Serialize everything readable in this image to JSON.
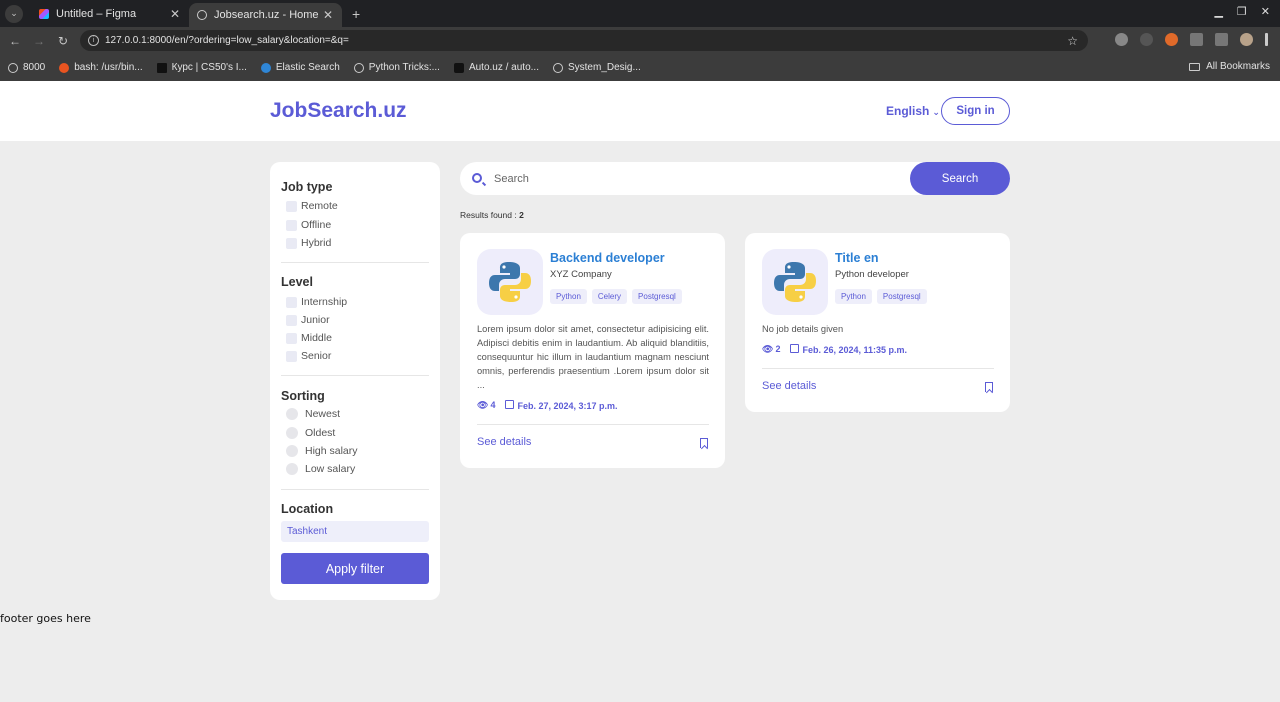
{
  "browser": {
    "tabs": [
      {
        "title": "Untitled – Figma",
        "active": false
      },
      {
        "title": "Jobsearch.uz - Home",
        "active": true
      }
    ],
    "url": "127.0.0.1:8000/en/?ordering=low_salary&location=&q=",
    "bookmarks": [
      "8000",
      "bash: /usr/bin...",
      "Курс | CS50's I...",
      "Elastic Search",
      "Python Tricks:...",
      "Auto.uz / auto...",
      "System_Desig..."
    ],
    "all_bookmarks": "All Bookmarks"
  },
  "header": {
    "logo": "JobSearch.uz",
    "language": "English",
    "signin": "Sign in"
  },
  "filters": {
    "job_type": {
      "title": "Job type",
      "options": [
        "Remote",
        "Offline",
        "Hybrid"
      ]
    },
    "level": {
      "title": "Level",
      "options": [
        "Internship",
        "Junior",
        "Middle",
        "Senior"
      ]
    },
    "sorting": {
      "title": "Sorting",
      "options": [
        "Newest",
        "Oldest",
        "High salary",
        "Low salary"
      ]
    },
    "location": {
      "title": "Location",
      "value": "Tashkent"
    },
    "apply": "Apply filter"
  },
  "search": {
    "placeholder": "Search",
    "button": "Search",
    "results_label": "Results found : ",
    "results_count": "2"
  },
  "jobs": [
    {
      "title": "Backend developer",
      "company": "XYZ Company",
      "tags": [
        "Python",
        "Celery",
        "Postgresql"
      ],
      "description": "Lorem ipsum dolor sit amet, consectetur adipisicing elit. Adipisci debitis enim in laudantium. Ab aliquid blanditiis, consequuntur hic illum in laudantium magnam nesciunt omnis, perferendis praesentium .Lorem ipsum dolor sit ...",
      "views": "4",
      "date": "Feb. 27, 2024, 3:17 p.m.",
      "details": "See details"
    },
    {
      "title": "Title en",
      "company": "Python developer",
      "tags": [
        "Python",
        "Postgresql"
      ],
      "description": "No job details given",
      "views": "2",
      "date": "Feb. 26, 2024, 11:35 p.m.",
      "details": "See details"
    }
  ],
  "footer": "footer goes here",
  "colors": {
    "accent": "#5b5bd6",
    "title_blue": "#2b7fd4",
    "page_bg": "#ededed"
  }
}
